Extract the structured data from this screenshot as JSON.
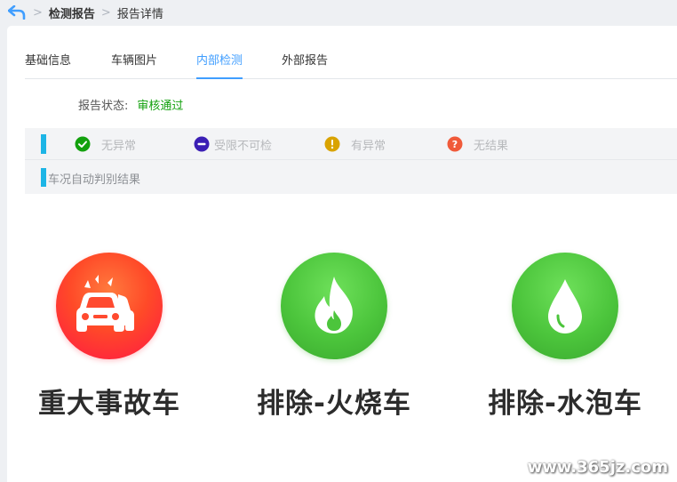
{
  "breadcrumb": {
    "items": [
      "检测报告",
      "报告详情"
    ]
  },
  "tabs": [
    {
      "label": "基础信息",
      "active": false
    },
    {
      "label": "车辆图片",
      "active": false
    },
    {
      "label": "内部检测",
      "active": true
    },
    {
      "label": "外部报告",
      "active": false
    }
  ],
  "status": {
    "label": "报告状态:",
    "value": "审核通过"
  },
  "legend": {
    "items": [
      {
        "label": "无异常",
        "icon": "check-circle-icon",
        "color": "#13a10e"
      },
      {
        "label": "受限不可检",
        "icon": "minus-circle-icon",
        "color": "#3b1fb5"
      },
      {
        "label": "有异常",
        "icon": "exclamation-circle-icon",
        "color": "#d9a300"
      },
      {
        "label": "无结果",
        "icon": "question-circle-icon",
        "color": "#f05a3a"
      }
    ],
    "section_label": "车况自动判别结果",
    "accent": "#1db5e6"
  },
  "results": [
    {
      "label": "重大事故车",
      "icon": "car-crash-icon",
      "color": "#ff3b30"
    },
    {
      "label": "排除-火烧车",
      "icon": "flame-icon",
      "color": "#4cc53c"
    },
    {
      "label": "排除-水泡车",
      "icon": "water-drop-icon",
      "color": "#4cc53c"
    }
  ],
  "watermark": "www.365jz.com"
}
